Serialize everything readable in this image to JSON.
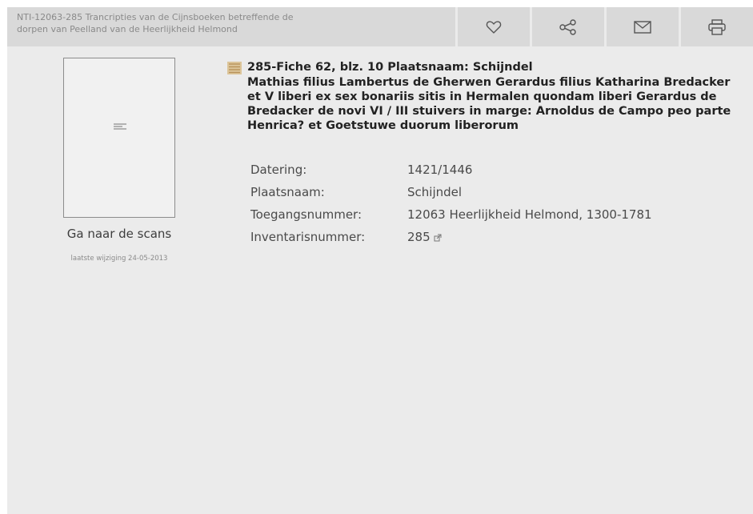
{
  "breadcrumb": {
    "line1": "NTI-12063-285 Trancripties van de Cijnsboeken betreffende de",
    "line2": "dorpen van Peelland van de Heerlijkheid Helmond"
  },
  "actions": [
    {
      "icon": "heart-icon",
      "label": "favorite"
    },
    {
      "icon": "share-icon",
      "label": "share"
    },
    {
      "icon": "mail-icon",
      "label": "email"
    },
    {
      "icon": "print-icon",
      "label": "print"
    }
  ],
  "scan": {
    "link_label": "Ga naar de scans",
    "modified": "laatste wijziging 24-05-2013"
  },
  "record": {
    "title": "285-Fiche 62, blz. 10 Plaatsnaam: Schijndel",
    "desc_lines": [
      "Mathias filius Lambertus de Gherwen Gerardus filius Katharina Bredacker",
      "et V liberi ex sex bonariis sitis in Hermalen quondam liberi Gerardus de",
      "Bredacker de novi VI / III stuivers in marge: Arnoldus de Campo peo parte",
      "Henrica? et Goetstuwe duorum liberorum"
    ],
    "meta": [
      {
        "label": "Datering:",
        "value": "1421/1446"
      },
      {
        "label": "Plaatsnaam:",
        "value": "Schijndel"
      },
      {
        "label": "Toegangsnummer:",
        "value": "12063 Heerlijkheid Helmond, 1300-1781"
      },
      {
        "label": "Inventarisnummer:",
        "value": "285"
      }
    ]
  },
  "colors": {
    "background": "#ebebeb",
    "toolbar": "#d9d9d9",
    "text": "#222222",
    "muted": "#8a8a8a",
    "doc_icon": "#c9a66b"
  }
}
